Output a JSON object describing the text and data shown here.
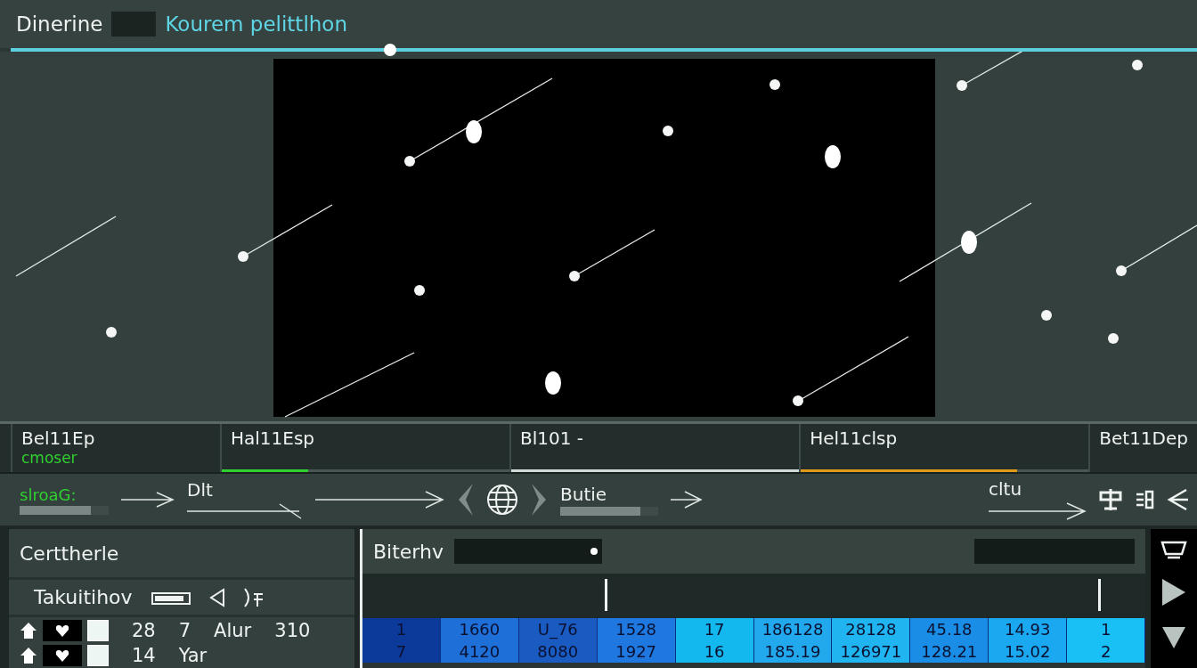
{
  "header": {
    "title": "Dinerine",
    "subtitle": "Kourem pelittlhon"
  },
  "scrubber": {
    "level": 0.32
  },
  "segments": [
    {
      "label": "Bel11Ep",
      "sublabel": "cmoser",
      "kind": "plain"
    },
    {
      "label": "Hal11Esp",
      "kind": "bar",
      "level": 0.3,
      "color": "#2fd02f"
    },
    {
      "label": "Bl101 -",
      "kind": "line"
    },
    {
      "label": "Hel11clsp",
      "kind": "bar",
      "level": 0.75,
      "color": "#e09a1a"
    },
    {
      "label": "Bet11Dep",
      "kind": "plain"
    }
  ],
  "controls": {
    "status": "slroaG:",
    "status_meter": {
      "level": 0.8
    },
    "label_2": "Dlt",
    "label_3": "Butie",
    "label_3_meter": {
      "level": 0.82
    },
    "label_4": "cltu"
  },
  "left_panel": {
    "title": "Certtherle",
    "subtitle": "Takuitihov",
    "rows": [
      {
        "cells": [
          "28",
          "7",
          "Alur",
          "310"
        ],
        "checked": true
      },
      {
        "cells": [
          "14",
          "Yar"
        ],
        "checked": true
      }
    ]
  },
  "right_panel": {
    "title": "Biterhv",
    "rows": [
      {
        "cells": [
          {
            "text": "1",
            "color": "#0b3a9a"
          },
          {
            "text": "1660",
            "color": "#1e6fd8"
          },
          {
            "text": "U_76",
            "color": "#1a5bc2"
          },
          {
            "text": "1528",
            "color": "#1e78e0"
          },
          {
            "text": "17",
            "color": "#12b8ee"
          },
          {
            "text": "186128",
            "color": "#22a8ec"
          },
          {
            "text": "28128",
            "color": "#20b4f0"
          },
          {
            "text": "45.18",
            "color": "#1a8ee6"
          },
          {
            "text": "14.93",
            "color": "#1aa8f0"
          },
          {
            "text": "1",
            "color": "#18c0f6"
          }
        ]
      },
      {
        "cells": [
          {
            "text": "7",
            "color": "#0b3a9a"
          },
          {
            "text": "4120",
            "color": "#1e6fd8"
          },
          {
            "text": "8080",
            "color": "#1a5bc2"
          },
          {
            "text": "1927",
            "color": "#1e78e0"
          },
          {
            "text": "16",
            "color": "#12b8ee"
          },
          {
            "text": "185.19",
            "color": "#22a8ec"
          },
          {
            "text": "126971",
            "color": "#20b4f0"
          },
          {
            "text": "128.21",
            "color": "#1a8ee6"
          },
          {
            "text": "15.02",
            "color": "#1aa8f0"
          },
          {
            "text": "2",
            "color": "#18c0f6"
          }
        ]
      }
    ]
  }
}
